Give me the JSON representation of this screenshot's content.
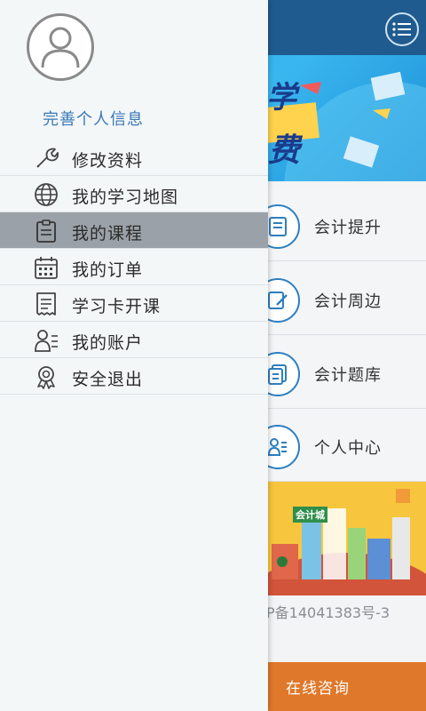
{
  "drawer": {
    "complete_profile": "完善个人信息",
    "items": [
      {
        "label": "修改资料",
        "icon": "wrench-icon"
      },
      {
        "label": "我的学习地图",
        "icon": "globe-icon"
      },
      {
        "label": "我的课程",
        "icon": "clipboard-icon",
        "active": true
      },
      {
        "label": "我的订单",
        "icon": "calendar-icon"
      },
      {
        "label": "学习卡开课",
        "icon": "receipt-icon"
      },
      {
        "label": "我的账户",
        "icon": "user-list-icon"
      },
      {
        "label": "安全退出",
        "icon": "award-icon"
      }
    ]
  },
  "background": {
    "features": [
      {
        "label": "会计提升"
      },
      {
        "label": "会计周边"
      },
      {
        "label": "会计题库"
      },
      {
        "label": "个人中心"
      }
    ],
    "icp": "P备14041383号-3",
    "consult": "在线咨询",
    "banner_glyphs": [
      "学",
      "费"
    ],
    "promo_sign": "会计城"
  },
  "colors": {
    "header": "#1f5b8f",
    "accent": "#2d7fc0",
    "consult": "#e0782b",
    "active_item": "#9aa1a8"
  }
}
